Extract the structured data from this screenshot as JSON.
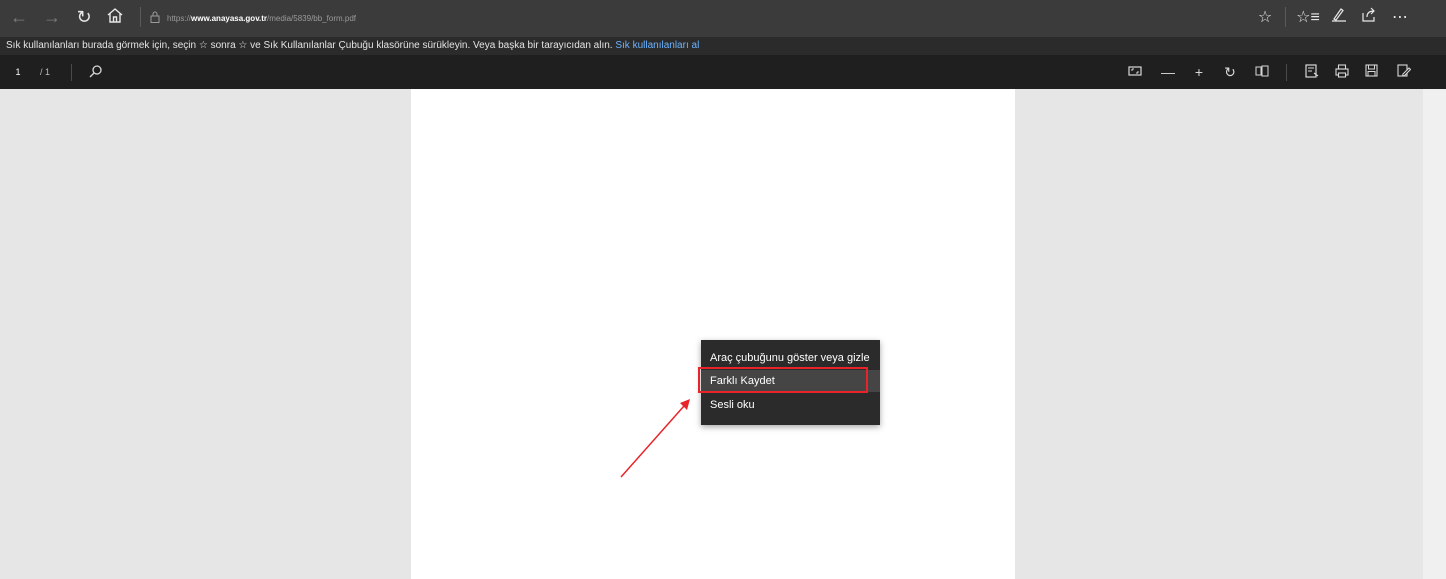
{
  "browser": {
    "url_prefix": "https://",
    "url_domain": "www.anayasa.gov.tr",
    "url_path": "/media/5839/bb_form.pdf"
  },
  "favorites_bar": {
    "message": "Sık kullanılanları burada görmek için, seçin ☆ sonra ☆ ve Sık Kullanılanlar Çubuğu klasörüne sürükleyin. Veya başka bir tarayıcıdan alın.",
    "link": "Sık kullanılanları al"
  },
  "pdf_toolbar": {
    "page_current": "1",
    "page_total": "/ 1"
  },
  "context_menu": {
    "items": [
      {
        "label": "Araç çubuğunu göster veya gizle"
      },
      {
        "label": "Farklı Kaydet"
      },
      {
        "label": "Sesli oku"
      }
    ]
  },
  "annotation": {
    "highlight_color": "#e8242a",
    "arrow_color": "#e8242a"
  },
  "icons": {
    "back": "arrow-left-icon",
    "forward": "arrow-right-icon",
    "refresh": "refresh-icon",
    "home": "home-icon",
    "lock": "lock-icon",
    "favorite": "star-icon",
    "favorites_list": "favorites-icon",
    "pen": "pen-icon",
    "share": "share-icon",
    "more": "more-icon",
    "search": "search-icon",
    "fit": "fit-page-icon",
    "zoom_out": "minus-icon",
    "zoom_in": "plus-icon",
    "rotate": "rotate-icon",
    "layout": "page-layout-icon",
    "read_aloud": "read-aloud-icon",
    "print": "print-icon",
    "save": "save-icon",
    "save_as": "save-as-icon"
  }
}
